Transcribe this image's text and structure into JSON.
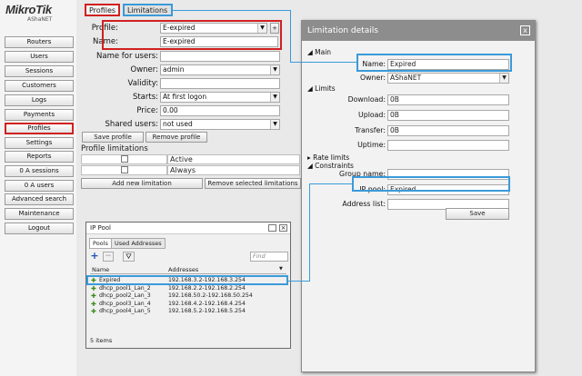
{
  "brand": {
    "name": "MikroTik",
    "sub": "AShaNET"
  },
  "nav": [
    "Routers",
    "Users",
    "Sessions",
    "Customers",
    "Logs",
    "Payments",
    "Profiles",
    "Settings",
    "Reports",
    "0 A sessions",
    "0 A users",
    "Advanced search",
    "Maintenance",
    "Logout"
  ],
  "tabs": {
    "profiles": "Profiles",
    "limitations": "Limitations"
  },
  "profile": {
    "profile_label": "Profile:",
    "profile_value": "E-expired",
    "name_label": "Name:",
    "name_value": "E-expired",
    "name_for_users_label": "Name for users:",
    "name_for_users_value": "",
    "owner_label": "Owner:",
    "owner_value": "admin",
    "validity_label": "Validity:",
    "validity_value": "",
    "starts_label": "Starts:",
    "starts_value": "At first logon",
    "price_label": "Price:",
    "price_value": "0.00",
    "shared_label": "Shared users:",
    "shared_value": "not used",
    "save_label": "Save profile",
    "remove_label": "Remove profile",
    "limitations_title": "Profile limitations",
    "lim_rows": [
      "Active",
      "Always"
    ],
    "add_lim_label": "Add new limitation",
    "remove_lim_label": "Remove selected limitations",
    "add_small": "+"
  },
  "ippool": {
    "title": "IP Pool",
    "tabs": [
      "Pools",
      "Used Addresses"
    ],
    "find_placeholder": "Find",
    "col_name": "Name",
    "col_addr": "Addresses",
    "rows": [
      {
        "name": "Expired",
        "addr": "192.168.3.2-192.168.3.254"
      },
      {
        "name": "dhcp_pool1_Lan_2",
        "addr": "192.168.2.2-192.168.2.254"
      },
      {
        "name": "dhcp_pool2_Lan_3",
        "addr": "192.168.50.2-192.168.50.254"
      },
      {
        "name": "dhcp_pool3_Lan_4",
        "addr": "192.168.4.2-192.168.4.254"
      },
      {
        "name": "dhcp_pool4_Lan_5",
        "addr": "192.168.5.2-192.168.5.254"
      }
    ],
    "count": "5 items"
  },
  "limitation": {
    "title": "Limitation details",
    "close": "x",
    "main": "Main",
    "name_label": "Name:",
    "name_value": "Expired",
    "owner_label": "Owner:",
    "owner_value": "AShaNET",
    "limits": "Limits",
    "download_label": "Download:",
    "download_value": "0B",
    "upload_label": "Upload:",
    "upload_value": "0B",
    "transfer_label": "Transfer:",
    "transfer_value": "0B",
    "uptime_label": "Uptime:",
    "uptime_value": "",
    "rate_limits": "Rate limits",
    "constraints": "Constraints",
    "group_label": "Group name:",
    "group_value": "",
    "ippool_label": "IP pool:",
    "ippool_value": "Expired",
    "address_label": "Address list:",
    "address_value": "",
    "save": "Save"
  },
  "colors": {
    "highlight_red": "#d02020",
    "highlight_blue": "#3a9ad9",
    "title_bar": "#8d8d8d"
  }
}
